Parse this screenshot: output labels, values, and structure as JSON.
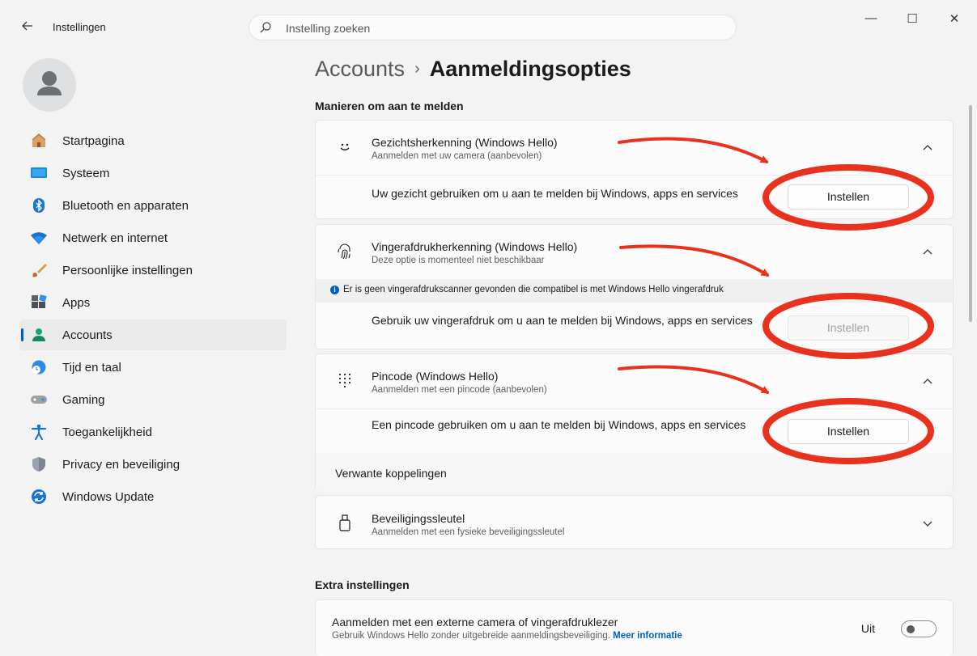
{
  "window": {
    "app_title": "Instellingen",
    "controls": {
      "minimize": "—",
      "maximize": "☐",
      "close": "✕"
    }
  },
  "search": {
    "placeholder": "Instelling zoeken"
  },
  "sidebar": {
    "items": [
      {
        "label": "Startpagina",
        "icon": "home-icon"
      },
      {
        "label": "Systeem",
        "icon": "monitor-icon"
      },
      {
        "label": "Bluetooth en apparaten",
        "icon": "bluetooth-icon"
      },
      {
        "label": "Netwerk en internet",
        "icon": "wifi-icon"
      },
      {
        "label": "Persoonlijke instellingen",
        "icon": "brush-icon"
      },
      {
        "label": "Apps",
        "icon": "apps-icon"
      },
      {
        "label": "Accounts",
        "icon": "person-icon",
        "active": true
      },
      {
        "label": "Tijd en taal",
        "icon": "globe-clock-icon"
      },
      {
        "label": "Gaming",
        "icon": "gamepad-icon"
      },
      {
        "label": "Toegankelijkheid",
        "icon": "accessibility-icon"
      },
      {
        "label": "Privacy en beveiliging",
        "icon": "shield-icon"
      },
      {
        "label": "Windows Update",
        "icon": "update-icon"
      }
    ]
  },
  "main": {
    "breadcrumb": {
      "parent": "Accounts",
      "separator": "›",
      "current": "Aanmeldingsopties"
    },
    "section_sign_in": "Manieren om aan te melden",
    "face": {
      "title": "Gezichtsherkenning (Windows Hello)",
      "subtitle": "Aanmelden met uw camera (aanbevolen)",
      "body": "Uw gezicht gebruiken om u aan te melden bij Windows, apps en services",
      "button": "Instellen",
      "expanded": true
    },
    "fingerprint": {
      "title": "Vingerafdrukherkenning (Windows Hello)",
      "subtitle": "Deze optie is momenteel niet beschikbaar",
      "info": "Er is geen vingerafdrukscanner gevonden die compatibel is met Windows Hello vingerafdruk",
      "body": "Gebruik uw vingerafdruk om u aan te melden bij Windows, apps en services",
      "button": "Instellen",
      "button_disabled": true,
      "expanded": true
    },
    "pin": {
      "title": "Pincode (Windows Hello)",
      "subtitle": "Aanmelden met een pincode (aanbevolen)",
      "body": "Een pincode gebruiken om u aan te melden bij Windows, apps en services",
      "button": "Instellen",
      "related": "Verwante koppelingen",
      "expanded": true
    },
    "security_key": {
      "title": "Beveiligingssleutel",
      "subtitle": "Aanmelden met een fysieke beveiligingssleutel",
      "expanded": false
    },
    "section_extra": "Extra instellingen",
    "external_camera": {
      "title": "Aanmelden met een externe camera of vingerafdruklezer",
      "subtitle": "Gebruik Windows Hello zonder uitgebreide aanmeldingsbeveiliging.",
      "link": "Meer informatie",
      "toggle_label": "Uit",
      "toggle_on": false
    }
  },
  "colors": {
    "accent": "#005fb8",
    "annotation": "#e8321e",
    "background": "#f3f3f3",
    "card": "#fbfbfb"
  }
}
